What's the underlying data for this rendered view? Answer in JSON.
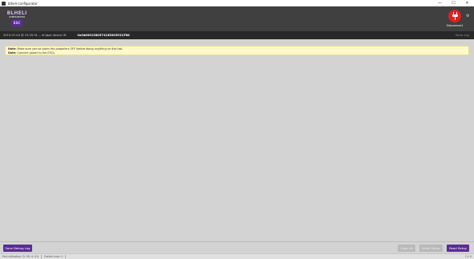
{
  "window": {
    "title": "blheli-configurator",
    "min_glyph": "—",
    "max_glyph": "☐",
    "close_glyph": "✕"
  },
  "header": {
    "logo_top": "BLHELI",
    "logo_mid": "CONFIGURATOR",
    "logo_badge": "ESC",
    "disconnect_label": "Disconnect",
    "settings_glyph": "⚙"
  },
  "status": {
    "timestamp": "2019-07-04 @ 15:35:31 -- Unique device ID",
    "unique_id": "0x0d0001560574185005931FB0",
    "show_log": "Show Log"
  },
  "note": {
    "line1_bold": "Note:",
    "line1_text": " Make sure you've taken the propellers OFF before doing anything on this tab.",
    "line2_bold": "Note:",
    "line2_text": " Connect power to the ESCs."
  },
  "footer": {
    "save_debug_log": "Save Debug Log",
    "clear_all": "Clear All",
    "write_setup": "Write Setup",
    "read_setup": "Read Setup"
  },
  "bottombar": {
    "port_utilization": "Port utilization: D: 0% U: 0%",
    "packet_error": "Packet error: 0",
    "version": "1.1.0"
  },
  "colors": {
    "accent": "#5a2d91",
    "disconnect": "#e02020",
    "header_bg": "#404040",
    "note_bg": "#fff8c9"
  }
}
